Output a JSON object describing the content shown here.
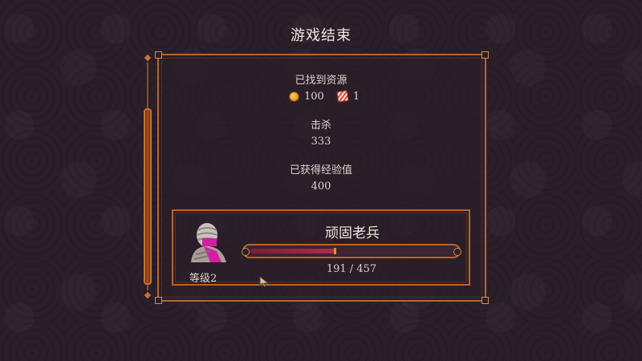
{
  "screen": {
    "title": "游戏结束"
  },
  "resources": {
    "label": "已找到资源",
    "gold_icon": "gold-coin-icon",
    "gold_value": "100",
    "item_icon": "striped-chest-icon",
    "item_value": "1"
  },
  "kills": {
    "label": "击杀",
    "value": "333"
  },
  "experience": {
    "label": "已获得经验值",
    "value": "400"
  },
  "hero": {
    "name": "顽固老兵",
    "level_label": "等级2",
    "xp_current": 191,
    "xp_max": 457,
    "xp_text": "191 / 457"
  },
  "colors": {
    "background": "#2b1f29",
    "border_accent": "#b8652a",
    "xp_fill": "#b02a55",
    "xp_edge": "#f08a2a",
    "text": "#ded3cb"
  }
}
